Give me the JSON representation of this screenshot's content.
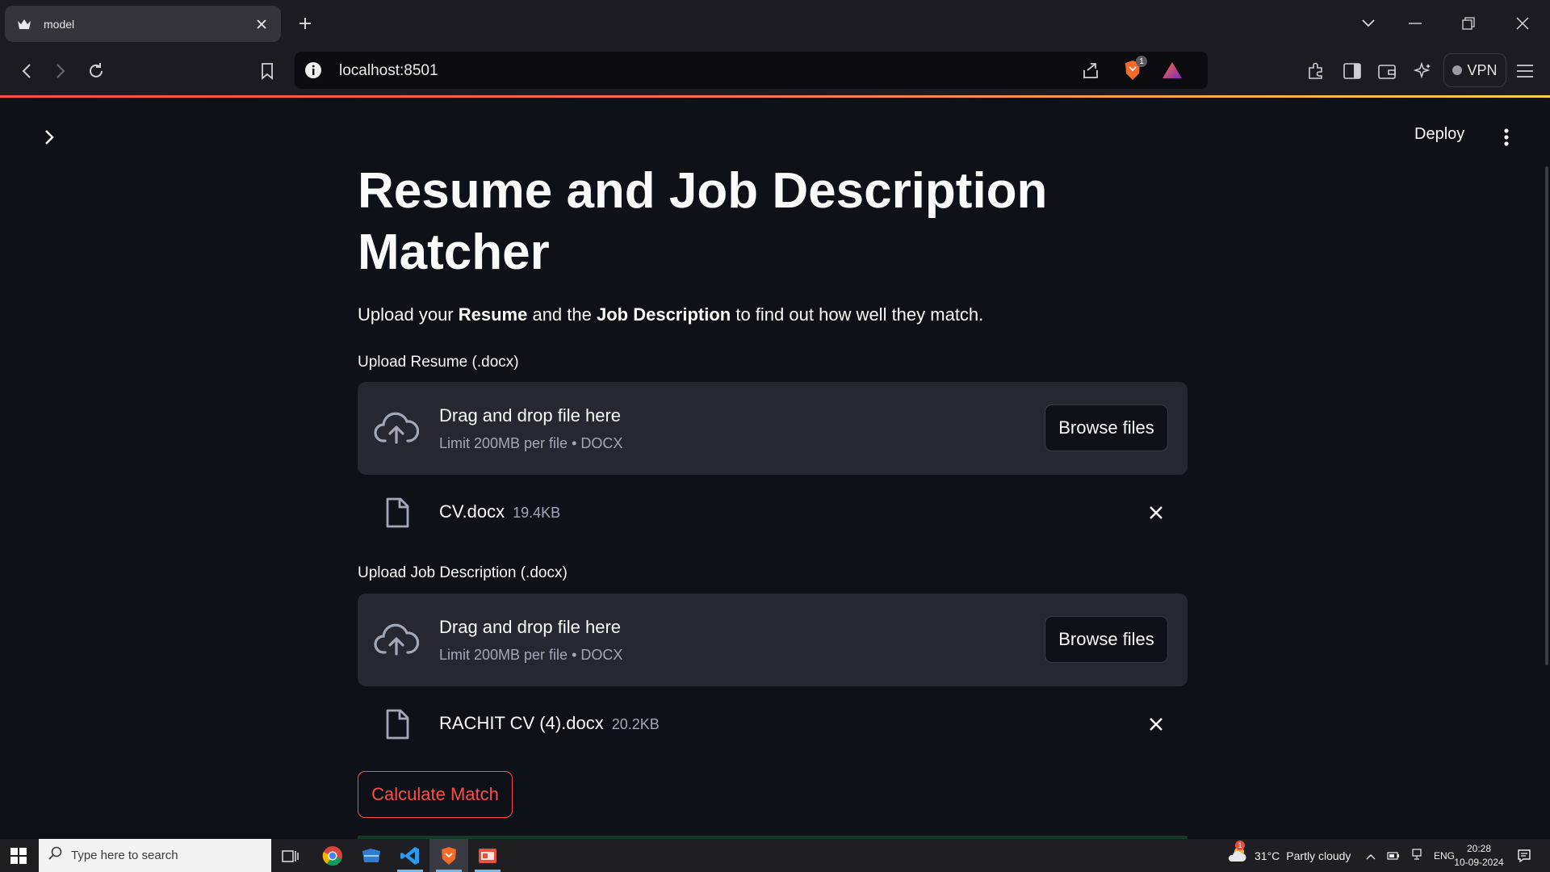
{
  "browser": {
    "tab_title": "model",
    "url": "localhost:8501",
    "shields_badge": "1",
    "vpn_label": "VPN"
  },
  "app": {
    "deploy_label": "Deploy",
    "title": "Resume and Job Description Matcher",
    "intro": {
      "part1": "Upload your ",
      "bold1": "Resume",
      "part2": " and the ",
      "bold2": "Job Description",
      "part3": " to find out how well they match."
    },
    "resume_uploader": {
      "label": "Upload Resume (.docx)",
      "drop_title": "Drag and drop file here",
      "drop_sub": "Limit 200MB per file • DOCX",
      "browse_label": "Browse files",
      "file_name": "CV.docx",
      "file_size": "19.4KB"
    },
    "jd_uploader": {
      "label": "Upload Job Description (.docx)",
      "drop_title": "Drag and drop file here",
      "drop_sub": "Limit 200MB per file • DOCX",
      "browse_label": "Browse files",
      "file_name": "RACHIT CV (4).docx",
      "file_size": "20.2KB"
    },
    "calculate_label": "Calculate Match",
    "accent_color": "#ff4b4b"
  },
  "taskbar": {
    "search_placeholder": "Type here to search",
    "weather_temp": "31°C",
    "weather_desc": "Partly cloudy",
    "lang": "ENG",
    "time": "20:28",
    "date": "10-09-2024",
    "notification_badge": "1"
  }
}
